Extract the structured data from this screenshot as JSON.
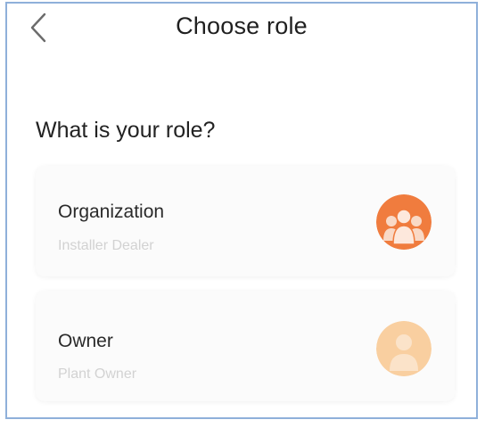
{
  "header": {
    "back_icon": "chevron-left-icon",
    "title": "Choose role"
  },
  "question": "What is your role?",
  "roles": [
    {
      "title": "Organization",
      "subtitle": "Installer Dealer",
      "icon": "group-users-icon",
      "icon_color": "#f07c3e"
    },
    {
      "title": "Owner",
      "subtitle": "Plant Owner",
      "icon": "single-user-icon",
      "icon_color": "#f9cfa0"
    }
  ],
  "colors": {
    "frame_border": "#8fb0da",
    "card_background": "#fbfbfb",
    "subtitle_text": "#d2d2d2"
  }
}
